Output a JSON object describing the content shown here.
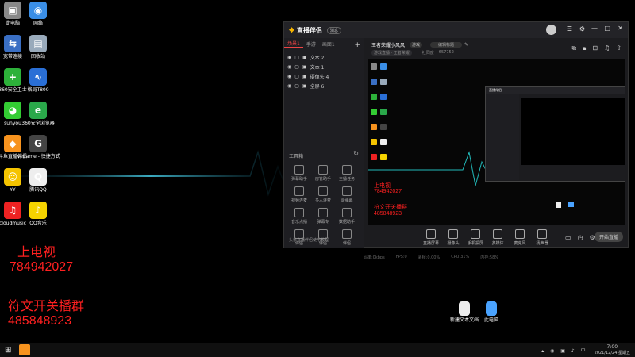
{
  "desktop": {
    "icons": [
      {
        "name": "此电脑",
        "glyph": "▣",
        "color": "#888"
      },
      {
        "name": "网络",
        "glyph": "◉",
        "color": "#3a8ee6"
      },
      {
        "name": "宽带连接",
        "glyph": "⇆",
        "color": "#3a6fc4"
      },
      {
        "name": "回收站",
        "glyph": "▤",
        "color": "#9ab"
      },
      {
        "name": "360安全卫士",
        "glyph": "+",
        "color": "#2db13a"
      },
      {
        "name": "格局T800",
        "glyph": "∿",
        "color": "#2a6fd6"
      },
      {
        "name": "sunyou",
        "glyph": "◕",
        "color": "#3c3"
      },
      {
        "name": "360安全浏览器",
        "glyph": "e",
        "color": "#2aa84a"
      },
      {
        "name": "斗鱼直播伴侣",
        "glyph": "◆",
        "color": "#f7931e"
      },
      {
        "name": "wegame - 快捷方式",
        "glyph": "G",
        "color": "#444"
      },
      {
        "name": "YY",
        "glyph": "☺",
        "color": "#f5c400"
      },
      {
        "name": "腾讯QQ",
        "glyph": "Q",
        "color": "#eee"
      },
      {
        "name": "cloudmusic",
        "glyph": "♫",
        "color": "#e22"
      },
      {
        "name": "QQ音乐",
        "glyph": "♪",
        "color": "#f5d300"
      }
    ],
    "bottom_icons": [
      {
        "name": "新建文本文档",
        "glyph": "▯",
        "color": "#eee"
      },
      {
        "name": "此电脑",
        "glyph": "▣",
        "color": "#4aa3ff"
      }
    ],
    "overlay_text": {
      "line1": "上电视",
      "line2": "784942027",
      "line3": "符文开关播群",
      "line4": "485848923"
    }
  },
  "app": {
    "title": "直播伴侣",
    "badge": "消息",
    "user_id": "6577752",
    "room_title": "王者荣耀小风风",
    "room_tag": "游戏",
    "edit_label": "编辑标题",
    "category": "游戏直播 · 王者荣耀",
    "online": "一社同度",
    "fans": "657752",
    "scene_tabs": [
      "场景1",
      "手游",
      "画面1"
    ],
    "sources": [
      {
        "label": "文本 2"
      },
      {
        "label": "文本 1"
      },
      {
        "label": "摄像头 4"
      },
      {
        "label": "全屏 6"
      }
    ],
    "tools_title": "工具箱",
    "tools": [
      "弹幕助手",
      "房管助手",
      "主播任务",
      "视频连麦",
      "多人连麦",
      "录弹幕",
      "音乐点播",
      "弹幕专",
      "数据助手",
      "伴侣",
      "伴侣",
      "伴侣"
    ],
    "bottom_buttons": [
      "直播屏幕",
      "摄像头",
      "手机投屏",
      "多媒体",
      "麦克风",
      "扬声器"
    ],
    "start_label": "开始直播",
    "status": [
      "码率:0kbps",
      "FPS:0",
      "丢帧:0.00%",
      "CPU:31%",
      "内存:58%"
    ],
    "preview_red": {
      "line1": "上电视",
      "line2": "784942027",
      "line3": "符文开关播群",
      "line4": "485848923"
    },
    "notice": "头条直播伴侣使用教程"
  },
  "taskbar": {
    "time": "7:00",
    "date": "2021/12/24 星期五"
  }
}
